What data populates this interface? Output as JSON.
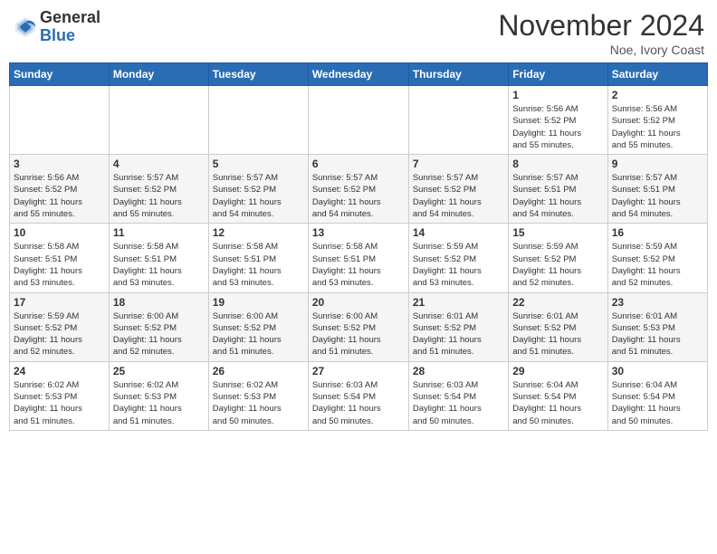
{
  "logo": {
    "text_general": "General",
    "text_blue": "Blue"
  },
  "header": {
    "month": "November 2024",
    "location": "Noe, Ivory Coast"
  },
  "days_of_week": [
    "Sunday",
    "Monday",
    "Tuesday",
    "Wednesday",
    "Thursday",
    "Friday",
    "Saturday"
  ],
  "weeks": [
    [
      {
        "day": "",
        "info": ""
      },
      {
        "day": "",
        "info": ""
      },
      {
        "day": "",
        "info": ""
      },
      {
        "day": "",
        "info": ""
      },
      {
        "day": "",
        "info": ""
      },
      {
        "day": "1",
        "info": "Sunrise: 5:56 AM\nSunset: 5:52 PM\nDaylight: 11 hours\nand 55 minutes."
      },
      {
        "day": "2",
        "info": "Sunrise: 5:56 AM\nSunset: 5:52 PM\nDaylight: 11 hours\nand 55 minutes."
      }
    ],
    [
      {
        "day": "3",
        "info": "Sunrise: 5:56 AM\nSunset: 5:52 PM\nDaylight: 11 hours\nand 55 minutes."
      },
      {
        "day": "4",
        "info": "Sunrise: 5:57 AM\nSunset: 5:52 PM\nDaylight: 11 hours\nand 55 minutes."
      },
      {
        "day": "5",
        "info": "Sunrise: 5:57 AM\nSunset: 5:52 PM\nDaylight: 11 hours\nand 54 minutes."
      },
      {
        "day": "6",
        "info": "Sunrise: 5:57 AM\nSunset: 5:52 PM\nDaylight: 11 hours\nand 54 minutes."
      },
      {
        "day": "7",
        "info": "Sunrise: 5:57 AM\nSunset: 5:52 PM\nDaylight: 11 hours\nand 54 minutes."
      },
      {
        "day": "8",
        "info": "Sunrise: 5:57 AM\nSunset: 5:51 PM\nDaylight: 11 hours\nand 54 minutes."
      },
      {
        "day": "9",
        "info": "Sunrise: 5:57 AM\nSunset: 5:51 PM\nDaylight: 11 hours\nand 54 minutes."
      }
    ],
    [
      {
        "day": "10",
        "info": "Sunrise: 5:58 AM\nSunset: 5:51 PM\nDaylight: 11 hours\nand 53 minutes."
      },
      {
        "day": "11",
        "info": "Sunrise: 5:58 AM\nSunset: 5:51 PM\nDaylight: 11 hours\nand 53 minutes."
      },
      {
        "day": "12",
        "info": "Sunrise: 5:58 AM\nSunset: 5:51 PM\nDaylight: 11 hours\nand 53 minutes."
      },
      {
        "day": "13",
        "info": "Sunrise: 5:58 AM\nSunset: 5:51 PM\nDaylight: 11 hours\nand 53 minutes."
      },
      {
        "day": "14",
        "info": "Sunrise: 5:59 AM\nSunset: 5:52 PM\nDaylight: 11 hours\nand 53 minutes."
      },
      {
        "day": "15",
        "info": "Sunrise: 5:59 AM\nSunset: 5:52 PM\nDaylight: 11 hours\nand 52 minutes."
      },
      {
        "day": "16",
        "info": "Sunrise: 5:59 AM\nSunset: 5:52 PM\nDaylight: 11 hours\nand 52 minutes."
      }
    ],
    [
      {
        "day": "17",
        "info": "Sunrise: 5:59 AM\nSunset: 5:52 PM\nDaylight: 11 hours\nand 52 minutes."
      },
      {
        "day": "18",
        "info": "Sunrise: 6:00 AM\nSunset: 5:52 PM\nDaylight: 11 hours\nand 52 minutes."
      },
      {
        "day": "19",
        "info": "Sunrise: 6:00 AM\nSunset: 5:52 PM\nDaylight: 11 hours\nand 51 minutes."
      },
      {
        "day": "20",
        "info": "Sunrise: 6:00 AM\nSunset: 5:52 PM\nDaylight: 11 hours\nand 51 minutes."
      },
      {
        "day": "21",
        "info": "Sunrise: 6:01 AM\nSunset: 5:52 PM\nDaylight: 11 hours\nand 51 minutes."
      },
      {
        "day": "22",
        "info": "Sunrise: 6:01 AM\nSunset: 5:52 PM\nDaylight: 11 hours\nand 51 minutes."
      },
      {
        "day": "23",
        "info": "Sunrise: 6:01 AM\nSunset: 5:53 PM\nDaylight: 11 hours\nand 51 minutes."
      }
    ],
    [
      {
        "day": "24",
        "info": "Sunrise: 6:02 AM\nSunset: 5:53 PM\nDaylight: 11 hours\nand 51 minutes."
      },
      {
        "day": "25",
        "info": "Sunrise: 6:02 AM\nSunset: 5:53 PM\nDaylight: 11 hours\nand 51 minutes."
      },
      {
        "day": "26",
        "info": "Sunrise: 6:02 AM\nSunset: 5:53 PM\nDaylight: 11 hours\nand 50 minutes."
      },
      {
        "day": "27",
        "info": "Sunrise: 6:03 AM\nSunset: 5:54 PM\nDaylight: 11 hours\nand 50 minutes."
      },
      {
        "day": "28",
        "info": "Sunrise: 6:03 AM\nSunset: 5:54 PM\nDaylight: 11 hours\nand 50 minutes."
      },
      {
        "day": "29",
        "info": "Sunrise: 6:04 AM\nSunset: 5:54 PM\nDaylight: 11 hours\nand 50 minutes."
      },
      {
        "day": "30",
        "info": "Sunrise: 6:04 AM\nSunset: 5:54 PM\nDaylight: 11 hours\nand 50 minutes."
      }
    ]
  ]
}
